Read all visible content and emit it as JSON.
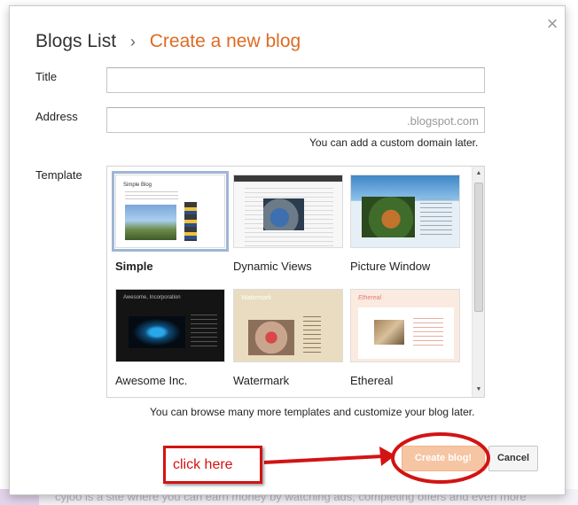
{
  "background": {
    "text": "cyjoo is a site where you can earn money by watching ads, completing offers and even more"
  },
  "dialog": {
    "close_glyph": "×",
    "breadcrumb": {
      "parent": "Blogs List",
      "separator": "›",
      "current": "Create a new blog"
    },
    "title_field": {
      "label": "Title",
      "value": ""
    },
    "address_field": {
      "label": "Address",
      "value": "",
      "suffix": ".blogspot.com",
      "hint": "You can add a custom domain later."
    },
    "template": {
      "label": "Template",
      "selected": "Simple",
      "items": [
        {
          "name": "Simple",
          "thumb_icon": "simple-template-thumbnail"
        },
        {
          "name": "Dynamic Views",
          "thumb_icon": "dynamic-views-template-thumbnail"
        },
        {
          "name": "Picture Window",
          "thumb_icon": "picture-window-template-thumbnail"
        },
        {
          "name": "Awesome Inc.",
          "thumb_icon": "awesome-inc-template-thumbnail"
        },
        {
          "name": "Watermark",
          "thumb_icon": "watermark-template-thumbnail"
        },
        {
          "name": "Ethereal",
          "thumb_icon": "ethereal-template-thumbnail"
        }
      ],
      "hint": "You can browse many more templates and customize your blog later."
    },
    "buttons": {
      "create": "Create blog!",
      "cancel": "Cancel"
    }
  },
  "annotation": {
    "label": "click here",
    "color": "#d31313"
  },
  "colors": {
    "accent": "#dd6b24",
    "create_button": "#f6c5a3",
    "selection_outline": "#9fb6d4"
  }
}
